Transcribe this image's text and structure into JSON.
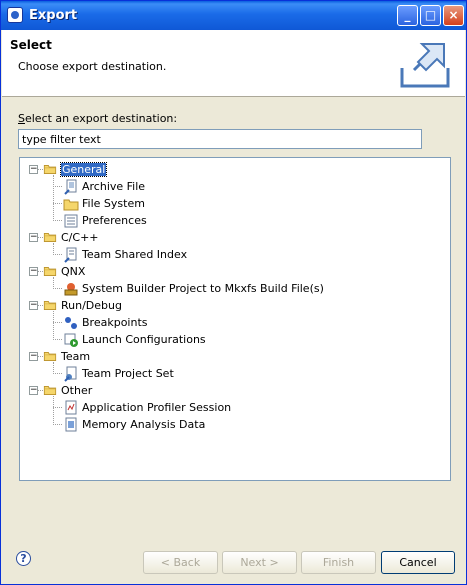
{
  "window": {
    "title": "Export"
  },
  "header": {
    "title": "Select",
    "subtitle": "Choose export destination."
  },
  "content": {
    "select_label_accel": "S",
    "select_label_rest": "elect an export destination:",
    "filter_value": "type filter text"
  },
  "tree": [
    {
      "label": "General",
      "expanded": true,
      "selected": true,
      "children": [
        {
          "label": "Archive File",
          "icon": "archive-file-icon"
        },
        {
          "label": "File System",
          "icon": "folder-icon"
        },
        {
          "label": "Preferences",
          "icon": "preferences-icon"
        }
      ]
    },
    {
      "label": "C/C++",
      "expanded": true,
      "children": [
        {
          "label": "Team Shared Index",
          "icon": "shared-index-icon"
        }
      ]
    },
    {
      "label": "QNX",
      "expanded": true,
      "children": [
        {
          "label": "System Builder Project to Mkxfs Build File(s)",
          "icon": "system-builder-icon"
        }
      ]
    },
    {
      "label": "Run/Debug",
      "expanded": true,
      "children": [
        {
          "label": "Breakpoints",
          "icon": "breakpoints-icon"
        },
        {
          "label": "Launch Configurations",
          "icon": "launch-config-icon"
        }
      ]
    },
    {
      "label": "Team",
      "expanded": true,
      "children": [
        {
          "label": "Team Project Set",
          "icon": "team-project-set-icon"
        }
      ]
    },
    {
      "label": "Other",
      "expanded": true,
      "children": [
        {
          "label": "Application Profiler Session",
          "icon": "profiler-session-icon"
        },
        {
          "label": "Memory Analysis Data",
          "icon": "memory-analysis-icon"
        }
      ]
    }
  ],
  "footer": {
    "back_label": "< Back",
    "next_label": "Next >",
    "finish_label": "Finish",
    "cancel_label": "Cancel"
  },
  "colors": {
    "selection": "#316ac5",
    "titlebar": "#0f58d6",
    "dialog_bg": "#ece9d8"
  }
}
